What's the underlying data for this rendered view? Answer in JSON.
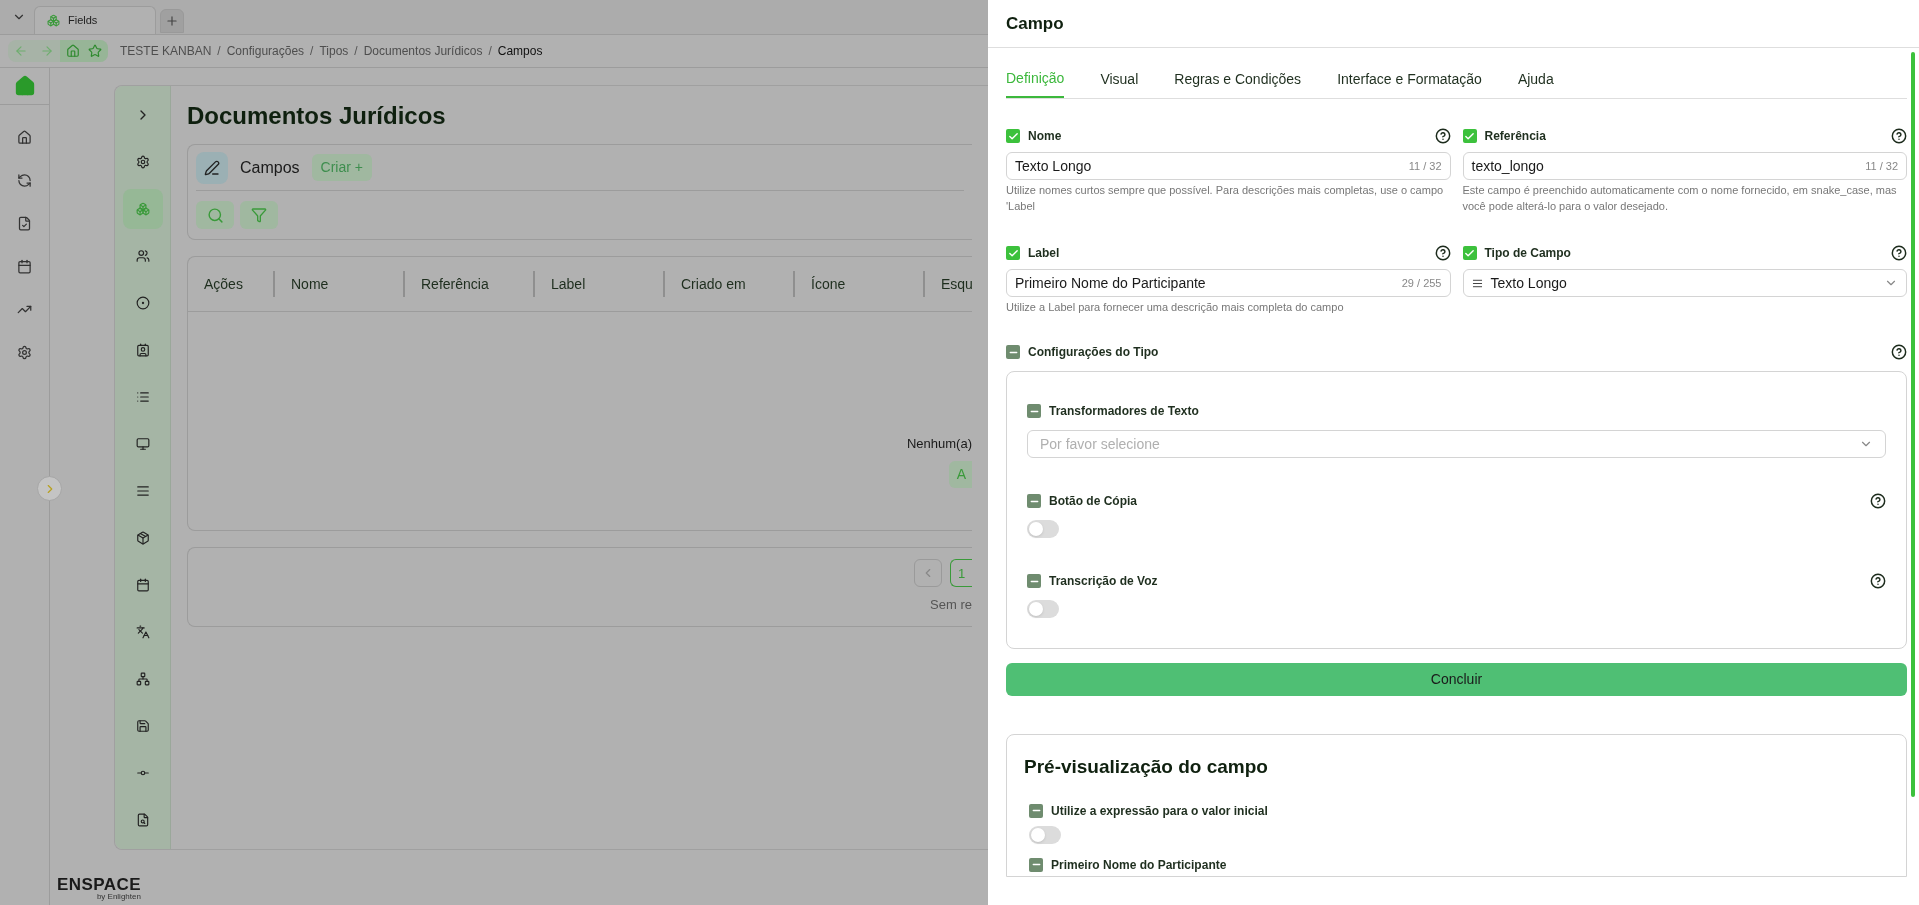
{
  "browser": {
    "tabs": [
      {
        "label": "Fields",
        "selected": true
      }
    ],
    "breadcrumb": [
      {
        "label": "TESTE KANBAN",
        "current": false
      },
      {
        "separator": "/",
        "label": "Configurações",
        "current": false
      },
      {
        "separator": "/",
        "label": "Tipos",
        "current": false
      },
      {
        "separator": "/",
        "label": "Documentos Jurídicos",
        "current": false
      },
      {
        "separator": "/",
        "label": "Campos",
        "current": true
      }
    ]
  },
  "brand": {
    "name": "ENSPACE",
    "tagline": "by Enlighten"
  },
  "rail": {
    "items": [
      {
        "kind": "home",
        "selected": false
      },
      {
        "kind": "sync",
        "selected": false
      },
      {
        "kind": "file",
        "selected": false
      },
      {
        "kind": "calendar",
        "selected": false
      },
      {
        "kind": "chart",
        "selected": false
      },
      {
        "kind": "settings",
        "selected": false
      }
    ]
  },
  "subnav": {
    "items": [
      {
        "kind": "settings",
        "selected": false
      },
      {
        "kind": "blocks",
        "selected": true
      },
      {
        "kind": "users",
        "selected": false
      },
      {
        "kind": "dots",
        "selected": false
      },
      {
        "kind": "contact",
        "selected": false
      },
      {
        "kind": "list",
        "selected": false
      },
      {
        "kind": "monitor",
        "selected": false
      },
      {
        "kind": "lines",
        "selected": false
      },
      {
        "kind": "box",
        "selected": false
      },
      {
        "kind": "calendar",
        "selected": false
      },
      {
        "kind": "translate",
        "selected": false
      },
      {
        "kind": "network",
        "selected": false
      },
      {
        "kind": "save",
        "selected": false
      },
      {
        "kind": "nodes",
        "selected": false
      },
      {
        "kind": "search-file",
        "selected": false
      }
    ]
  },
  "page": {
    "title": "Documentos Jurídicos",
    "section": "Campos",
    "create_button": "Criar +",
    "table": {
      "columns": [
        "Ações",
        "Nome",
        "Referência",
        "Label",
        "Criado em",
        "Ícone",
        "Esqu"
      ],
      "empty_text": "Nenhum(a)",
      "empty_button": "A"
    },
    "pagination": {
      "page": "1",
      "note": "Sem re"
    }
  },
  "drawer": {
    "title": "Campo",
    "tabs": [
      {
        "label": "Definição",
        "selected": true
      },
      {
        "label": "Visual",
        "selected": false
      },
      {
        "label": "Regras e Condições",
        "selected": false
      },
      {
        "label": "Interface e Formatação",
        "selected": false
      },
      {
        "label": "Ajuda",
        "selected": false
      }
    ],
    "fields": [
      {
        "kind": "text",
        "label": "Nome",
        "checked": true,
        "help": true,
        "value": "Texto Longo",
        "counter": "11 / 32",
        "hint": "Utilize nomes curtos sempre que possível. Para descrições mais completas, use o campo 'Label"
      },
      {
        "kind": "text",
        "label": "Referência",
        "checked": true,
        "help": true,
        "value": "texto_longo",
        "counter": "11 / 32",
        "hint": "Este campo é preenchido automaticamente com o nome fornecido, em snake_case, mas você pode alterá-lo para o valor desejado."
      },
      {
        "kind": "text",
        "label": "Label",
        "checked": true,
        "help": true,
        "value": "Primeiro Nome do Participante",
        "counter": "29 / 255",
        "hint": "Utilize a Label para fornecer uma descrição mais completa do campo"
      },
      {
        "kind": "select",
        "label": "Tipo de Campo",
        "checked": true,
        "help": true,
        "value": "Texto Longo"
      }
    ],
    "config": {
      "title": "Configurações do Tipo",
      "expanded": true,
      "help": true,
      "items": [
        {
          "kind": "select",
          "label": "Transformadores de Texto",
          "expanded": true,
          "help": false,
          "placeholder": "Por favor selecione"
        },
        {
          "kind": "toggle",
          "label": "Botão de Cópia",
          "expanded": true,
          "help": true,
          "on": false
        },
        {
          "kind": "toggle",
          "label": "Transcrição de Voz",
          "expanded": true,
          "help": true,
          "on": false
        }
      ]
    },
    "submit": "Concluir",
    "preview": {
      "title": "Pré-visualização do campo",
      "items": [
        {
          "kind": "toggle",
          "label": "Utilize a expressão para o valor inicial",
          "expanded": true,
          "on": false
        },
        {
          "kind": "label",
          "label": "Primeiro Nome do Participante",
          "expanded": true
        }
      ]
    }
  }
}
